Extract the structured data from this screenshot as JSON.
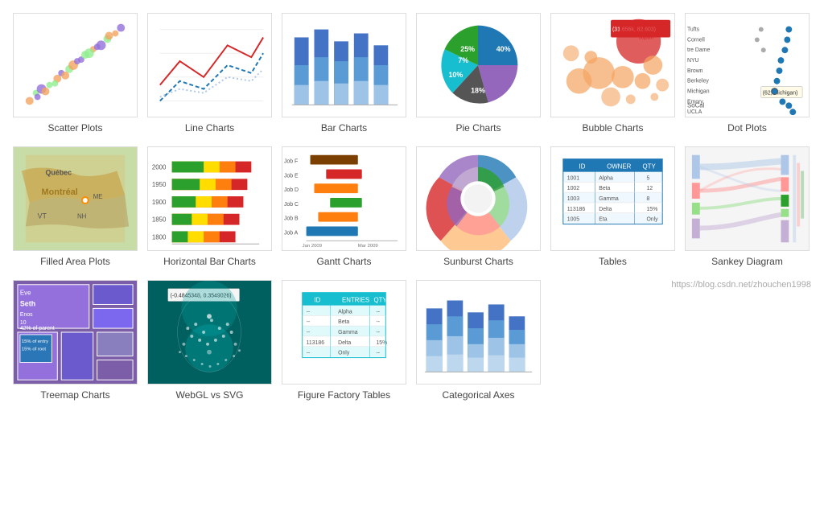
{
  "charts": [
    {
      "id": "scatter",
      "label": "Scatter Plots",
      "type": "scatter"
    },
    {
      "id": "line",
      "label": "Line Charts",
      "type": "line"
    },
    {
      "id": "bar",
      "label": "Bar Charts",
      "type": "bar"
    },
    {
      "id": "pie",
      "label": "Pie Charts",
      "type": "pie"
    },
    {
      "id": "bubble",
      "label": "Bubble Charts",
      "type": "bubble"
    },
    {
      "id": "dotplot",
      "label": "Dot Plots",
      "type": "dotplot"
    },
    {
      "id": "filledarea",
      "label": "Filled Area Plots",
      "type": "filledarea"
    },
    {
      "id": "hbar",
      "label": "Horizontal Bar Charts",
      "type": "hbar"
    },
    {
      "id": "gantt",
      "label": "Gantt Charts",
      "type": "gantt"
    },
    {
      "id": "sunburst",
      "label": "Sunburst Charts",
      "type": "sunburst"
    },
    {
      "id": "tables",
      "label": "Tables",
      "type": "tables"
    },
    {
      "id": "sankey",
      "label": "Sankey Diagram",
      "type": "sankey"
    },
    {
      "id": "treemap",
      "label": "Treemap Charts",
      "type": "treemap"
    },
    {
      "id": "webgl",
      "label": "WebGL vs SVG",
      "type": "webgl"
    },
    {
      "id": "figfac",
      "label": "Figure Factory Tables",
      "type": "figfac"
    },
    {
      "id": "catax",
      "label": "Categorical Axes",
      "type": "catax"
    }
  ],
  "footer": {
    "link": "https://blog.csdn.net/zhouchen1998"
  }
}
